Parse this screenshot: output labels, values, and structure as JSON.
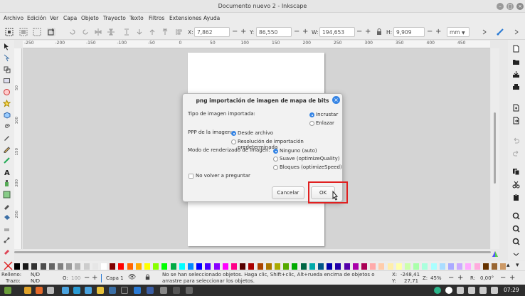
{
  "window": {
    "title": "Documento nuevo 2 - Inkscape"
  },
  "menu": [
    "Archivo",
    "Edición",
    "Ver",
    "Capa",
    "Objeto",
    "Trayecto",
    "Texto",
    "Filtros",
    "Extensiones",
    "Ayuda"
  ],
  "controls": {
    "x_label": "X:",
    "x_value": "7,862",
    "y_label": "Y:",
    "y_value": "86,550",
    "w_label": "W:",
    "w_value": "194,653",
    "h_label": "H:",
    "h_value": "9,909",
    "units": "mm",
    "minus": "−",
    "plus": "+"
  },
  "ruler": {
    "h_ticks": [
      "-250",
      "-200",
      "-150",
      "-100",
      "-50",
      "0",
      "50",
      "100",
      "150",
      "200",
      "250",
      "300",
      "350",
      "400",
      "450"
    ],
    "v_ticks": [
      "50",
      "100",
      "150",
      "200",
      "250"
    ]
  },
  "dialog": {
    "title": "png importación de imagen de mapa de bits",
    "type_label": "Tipo de imagen importada:",
    "type_options": [
      "Incrustar",
      "Enlazar"
    ],
    "ppp_label": "PPP de la imagen:",
    "ppp_options": [
      "Desde archivo",
      "Resolución de importación predeterminada"
    ],
    "render_label": "Modo de renderizado de imagen:",
    "render_options": [
      "Ninguno (auto)",
      "Suave (optimizeQuality)",
      "Bloques (optimizeSpeed)"
    ],
    "dont_ask": "No volver a preguntar",
    "cancel": "Cancelar",
    "ok": "OK"
  },
  "status": {
    "fill_label": "Relleno:",
    "fill_value": "N/D",
    "stroke_label": "Trazo:",
    "stroke_value": "N/D",
    "opacity_label": "O:",
    "opacity_value": "100",
    "layer": "Capa 1",
    "message": "No se han seleccionado objetos. Haga clic, Shift+clic, Alt+rueda encima de objetos o arrastre para seleccionar los objetos.",
    "x_label": "X:",
    "x_value": "-248,41",
    "y_label": "Y:",
    "y_value": "27,71",
    "zoom_label": "Z:",
    "zoom_value": "45%",
    "rot_label": "R:",
    "rot_value": "0,00°"
  },
  "taskbar": {
    "time": "07:29"
  },
  "colors": {
    "accent": "#3584e4",
    "highlight": "#e02020"
  }
}
